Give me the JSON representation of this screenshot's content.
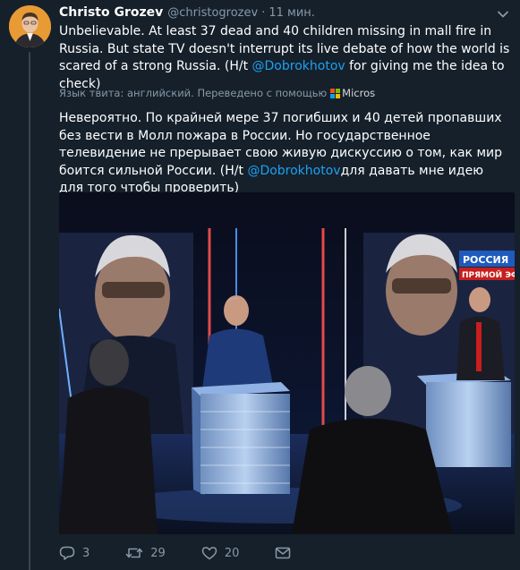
{
  "tweet": {
    "author_name": "Christo Grozev",
    "author_handle": "@christogrozev",
    "separator": "·",
    "time": "11 мин.",
    "text_before_mention": "Unbelievable. At least 37 dead and 40 children missing in mall fire in Russia. But state TV doesn't interrupt its live debate of how the world is scared of a strong Russia. (H/t ",
    "mention": "@Dobrokhotov",
    "text_after_mention": " for giving me the idea to check)"
  },
  "translation": {
    "note": "Язык твита: английский. Переведено с помощью",
    "provider": "Micros",
    "text_before_mention": "Невероятно. По крайней мере 37 погибших и 40 детей пропавших без вести в Молл пожара в России. Но государственное телевидение не прерывает свою живую дискуссию о том, как мир боится сильной России. (H/t ",
    "mention": "@Dobrokhotov",
    "text_after_mention": "для давать мне идею для того чтобы проверить)"
  },
  "media": {
    "channel_logo": "РОССИЯ",
    "live_badge": "ПРЯМОЙ ЭФ"
  },
  "actions": {
    "reply_count": "3",
    "retweet_count": "29",
    "like_count": "20"
  },
  "icons": {
    "reply": "reply-icon",
    "retweet": "retweet-icon",
    "like": "heart-icon",
    "message": "mail-icon",
    "more": "chevron-down-icon"
  },
  "colors": {
    "background": "#15202b",
    "link": "#1da1f2",
    "secondary_text": "#8899a6",
    "divider": "#38444d"
  }
}
